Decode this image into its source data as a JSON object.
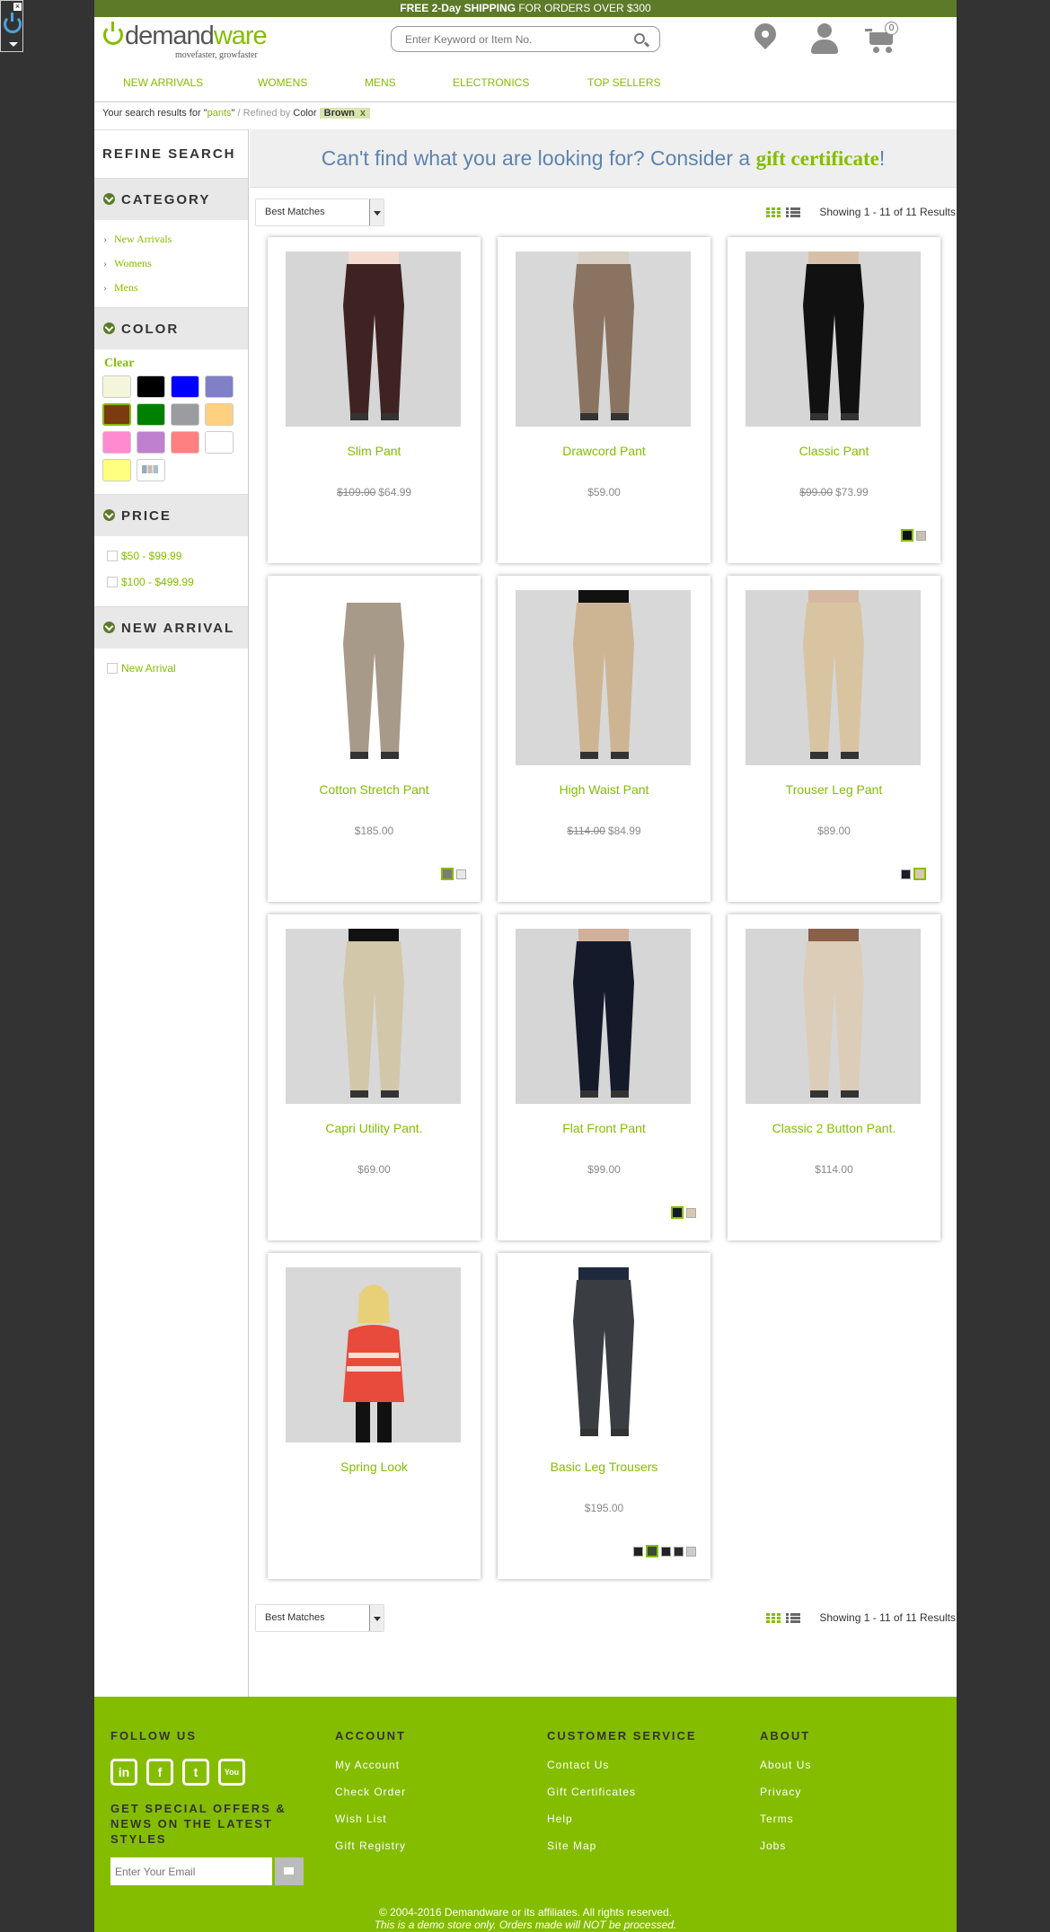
{
  "promo": {
    "bold": "FREE 2-Day SHIPPING",
    "rest": " FOR ORDERS OVER $300"
  },
  "logo": {
    "name_a": "demand",
    "name_b": "ware",
    "tagline": "movefaster, growfaster"
  },
  "search": {
    "placeholder": "Enter Keyword or Item No."
  },
  "cart": {
    "count": "0"
  },
  "nav": [
    "NEW ARRIVALS",
    "WOMENS",
    "MENS",
    "ELECTRONICS",
    "TOP SELLERS"
  ],
  "crumb": {
    "prefix": "Your search results for \"",
    "query": "pants",
    "suffix": "\"",
    "refined": " / Refined by ",
    "refine_attr": "Color",
    "chip": "Brown",
    "chip_x": "x"
  },
  "sidebar": {
    "title": "REFINE SEARCH",
    "category": {
      "title": "CATEGORY",
      "items": [
        "New Arrivals",
        "Womens",
        "Mens"
      ]
    },
    "color": {
      "title": "COLOR",
      "clear": "Clear",
      "swatches": [
        {
          "name": "beige",
          "hex": "#f5f5dc"
        },
        {
          "name": "black",
          "hex": "#000000"
        },
        {
          "name": "blue",
          "hex": "#0000ff"
        },
        {
          "name": "navy",
          "hex": "#8080c8"
        },
        {
          "name": "brown",
          "hex": "#7b3a10",
          "selected": true
        },
        {
          "name": "green",
          "hex": "#008000"
        },
        {
          "name": "grey",
          "hex": "#9a9ca0"
        },
        {
          "name": "orange",
          "hex": "#ffd080"
        },
        {
          "name": "pink",
          "hex": "#ff8ad0"
        },
        {
          "name": "purple",
          "hex": "#c080d0"
        },
        {
          "name": "red",
          "hex": "#ff8080"
        },
        {
          "name": "white",
          "hex": "#ffffff"
        },
        {
          "name": "yellow",
          "hex": "#ffff80"
        },
        {
          "name": "miscellaneous",
          "hex": "#ffffff",
          "multi": true
        }
      ]
    },
    "price": {
      "title": "PRICE",
      "items": [
        "$50 - $99.99",
        "$100 - $499.99"
      ]
    },
    "new_arrival": {
      "title": "NEW ARRIVAL",
      "items": [
        "New Arrival"
      ]
    }
  },
  "gift": {
    "text": "Can't find what you are looking for? Consider a ",
    "link": "gift certificate",
    "end": "!"
  },
  "sort": {
    "selected": "Best Matches",
    "showing": "Showing 1 - 11 of 11 Results"
  },
  "products": [
    {
      "name": "Slim Pant",
      "old": "$109.00",
      "price": "$64.99",
      "pant": "#3f2322",
      "top": "#f4dcd0",
      "bg": "#d6d6d6",
      "swatches": []
    },
    {
      "name": "Drawcord Pant",
      "old": "",
      "price": "$59.00",
      "pant": "#8a7360",
      "top": "#d8cfc5",
      "bg": "#d8d8d8",
      "swatches": []
    },
    {
      "name": "Classic Pant",
      "old": "$99.00",
      "price": "$73.99",
      "pant": "#111111",
      "top": "#d8c0a8",
      "bg": "#d6d6d6",
      "swatches": [
        {
          "hex": "#111111",
          "on": true
        },
        {
          "hex": "#c8c0b0"
        }
      ]
    },
    {
      "name": "Cotton Stretch Pant",
      "old": "",
      "price": "$185.00",
      "pant": "#a89a88",
      "top": "#ffffff",
      "bg": "#ffffff",
      "swatches": [
        {
          "hex": "#7a7d70",
          "on": true
        },
        {
          "hex": "#e8e8e8"
        }
      ]
    },
    {
      "name": "High Waist Pant",
      "old": "$114.00",
      "price": "$84.99",
      "pant": "#cdb594",
      "top": "#111111",
      "bg": "#d8d8d8",
      "swatches": []
    },
    {
      "name": "Trouser Leg Pant",
      "old": "",
      "price": "$89.00",
      "pant": "#d9c4a2",
      "top": "#d6b8a0",
      "bg": "#d6d6d6",
      "swatches": [
        {
          "hex": "#1c1c2c"
        },
        {
          "hex": "#d8c8a8",
          "on": true
        }
      ]
    },
    {
      "name": "Capri Utility Pant.",
      "old": "",
      "price": "$69.00",
      "pant": "#d3c7a9",
      "top": "#111111",
      "bg": "#d8d8d8",
      "swatches": []
    },
    {
      "name": "Flat Front Pant",
      "old": "",
      "price": "$99.00",
      "pant": "#141a2a",
      "top": "#d0b09a",
      "bg": "#d6d6d6",
      "swatches": [
        {
          "hex": "#141a2a",
          "on": true
        },
        {
          "hex": "#d8c8b0"
        }
      ]
    },
    {
      "name": "Classic 2 Button Pant.",
      "old": "",
      "price": "$114.00",
      "pant": "#dccdb8",
      "top": "#8a6048",
      "bg": "#d6d6d6",
      "swatches": []
    },
    {
      "name": "Spring Look",
      "old": "",
      "price": "",
      "pant": "#111111",
      "top": "#e84a3c",
      "bg": "#d8d8d8",
      "swatches": []
    },
    {
      "name": "Basic Leg Trousers",
      "old": "",
      "price": "$195.00",
      "pant": "#3a3d42",
      "top": "#1e2a3c",
      "bg": "#ffffff",
      "swatches": [
        {
          "hex": "#222222"
        },
        {
          "hex": "#3a4a3a",
          "on": true
        },
        {
          "hex": "#222222"
        },
        {
          "hex": "#2a2a2a"
        },
        {
          "hex": "#cccccc"
        }
      ]
    }
  ],
  "footer": {
    "follow": "FOLLOW US",
    "social": [
      "in",
      "f",
      "t",
      "You"
    ],
    "offers": "GET SPECIAL OFFERS & NEWS ON THE LATEST STYLES",
    "email_placeholder": "Enter Your Email",
    "account": {
      "title": "ACCOUNT",
      "links": [
        "My Account",
        "Check Order",
        "Wish List",
        "Gift Registry"
      ]
    },
    "service": {
      "title": "CUSTOMER SERVICE",
      "links": [
        "Contact Us",
        "Gift Certificates",
        "Help",
        "Site Map"
      ]
    },
    "about": {
      "title": "ABOUT",
      "links": [
        "About Us",
        "Privacy",
        "Terms",
        "Jobs"
      ]
    },
    "copyright": "© 2004-2016 Demandware or its affiliates. All rights reserved.",
    "demo": "This is a demo store only. Orders made will NOT be processed."
  }
}
